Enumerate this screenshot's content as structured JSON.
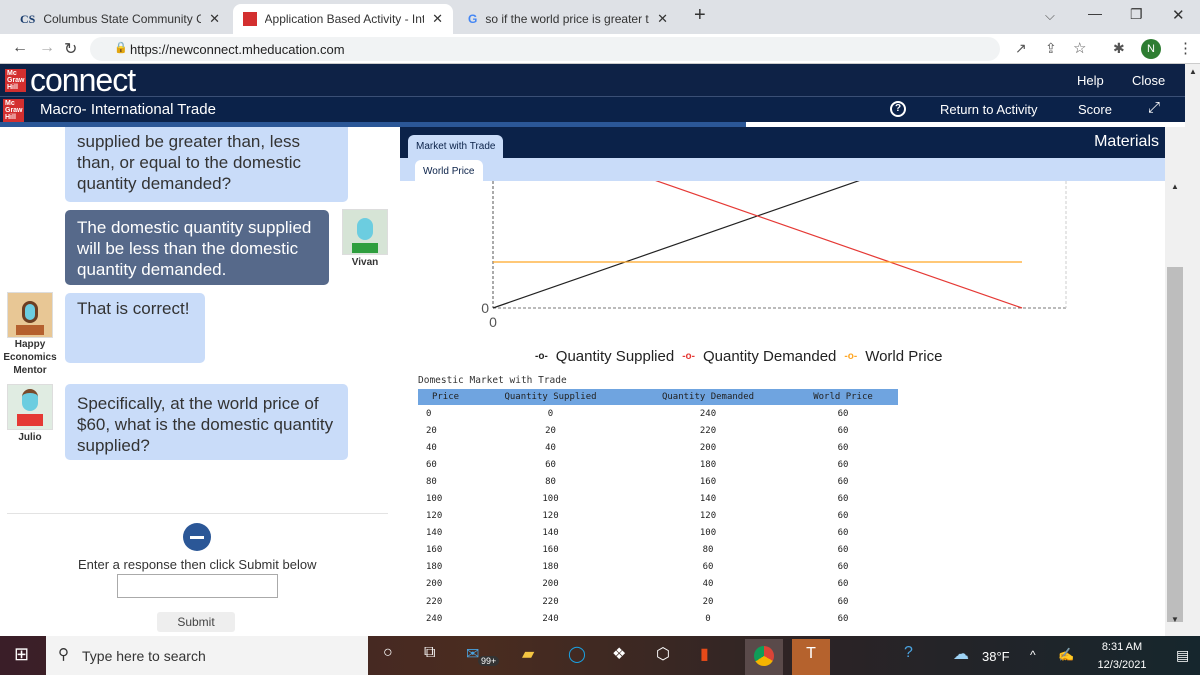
{
  "browser": {
    "tabs": [
      {
        "title": "Columbus State Community Colle",
        "icon": "cs-logo-icon"
      },
      {
        "title": "Application Based Activity - Inter",
        "icon": "mcgraw-hill-icon",
        "active": true
      },
      {
        "title": "so if the world price is greater tha",
        "icon": "google-icon"
      }
    ],
    "new_tab": "+",
    "url": "https://newconnect.mheducation.com",
    "profile_initial": "N"
  },
  "header": {
    "logo_text": "connect",
    "brand": "Mc Graw Hill",
    "help": "Help",
    "close": "Close",
    "course_title": "Macro- International Trade",
    "return": "Return to Activity",
    "score": "Score",
    "help_icon": "?"
  },
  "progress": {
    "percent": 64
  },
  "chat": {
    "messages": [
      {
        "text": "supplied be greater than, less than, or equal to the domestic quantity demanded?"
      },
      {
        "text": "The domestic quantity supplied will be less than the domestic quantity demanded.",
        "speaker": "Vivan"
      },
      {
        "text": "That is correct!",
        "speaker": "Happy Economics Mentor"
      },
      {
        "text": "Specifically, at the world price of $60, what is the domestic quantity supplied?",
        "speaker": "Julio"
      }
    ],
    "prompt": "Enter a response then click Submit below",
    "input_value": "",
    "submit": "Submit"
  },
  "materials": {
    "title": "Materials",
    "tab1": "Market with Trade",
    "tab2": "World Price"
  },
  "chart_data": {
    "type": "line",
    "x_tick": "0",
    "y_tick": "0",
    "xlim": [
      0,
      240
    ],
    "series": [
      {
        "name": "Quantity Supplied",
        "color": "#222222",
        "points": [
          [
            0,
            0
          ],
          [
            240,
            240
          ]
        ]
      },
      {
        "name": "Quantity Demanded",
        "color": "#e53935",
        "points": [
          [
            0,
            240
          ],
          [
            240,
            0
          ]
        ]
      },
      {
        "name": "World Price",
        "color": "#ffa726",
        "points": [
          [
            0,
            60
          ],
          [
            240,
            60
          ]
        ]
      }
    ],
    "legend": "bottom"
  },
  "table": {
    "caption": "Domestic Market with Trade",
    "headers": [
      "Price",
      "Quantity Supplied",
      "Quantity Demanded",
      "World Price"
    ],
    "rows": [
      [
        "0",
        "0",
        "240",
        "60"
      ],
      [
        "20",
        "20",
        "220",
        "60"
      ],
      [
        "40",
        "40",
        "200",
        "60"
      ],
      [
        "60",
        "60",
        "180",
        "60"
      ],
      [
        "80",
        "80",
        "160",
        "60"
      ],
      [
        "100",
        "100",
        "140",
        "60"
      ],
      [
        "120",
        "120",
        "120",
        "60"
      ],
      [
        "140",
        "140",
        "100",
        "60"
      ],
      [
        "160",
        "160",
        "80",
        "60"
      ],
      [
        "180",
        "180",
        "60",
        "60"
      ],
      [
        "200",
        "200",
        "40",
        "60"
      ],
      [
        "220",
        "220",
        "20",
        "60"
      ],
      [
        "240",
        "240",
        "0",
        "60"
      ]
    ]
  },
  "taskbar": {
    "search_placeholder": "Type here to search",
    "mail_badge": "99+",
    "weather": "38°F",
    "time": "8:31 AM",
    "date": "12/3/2021"
  }
}
